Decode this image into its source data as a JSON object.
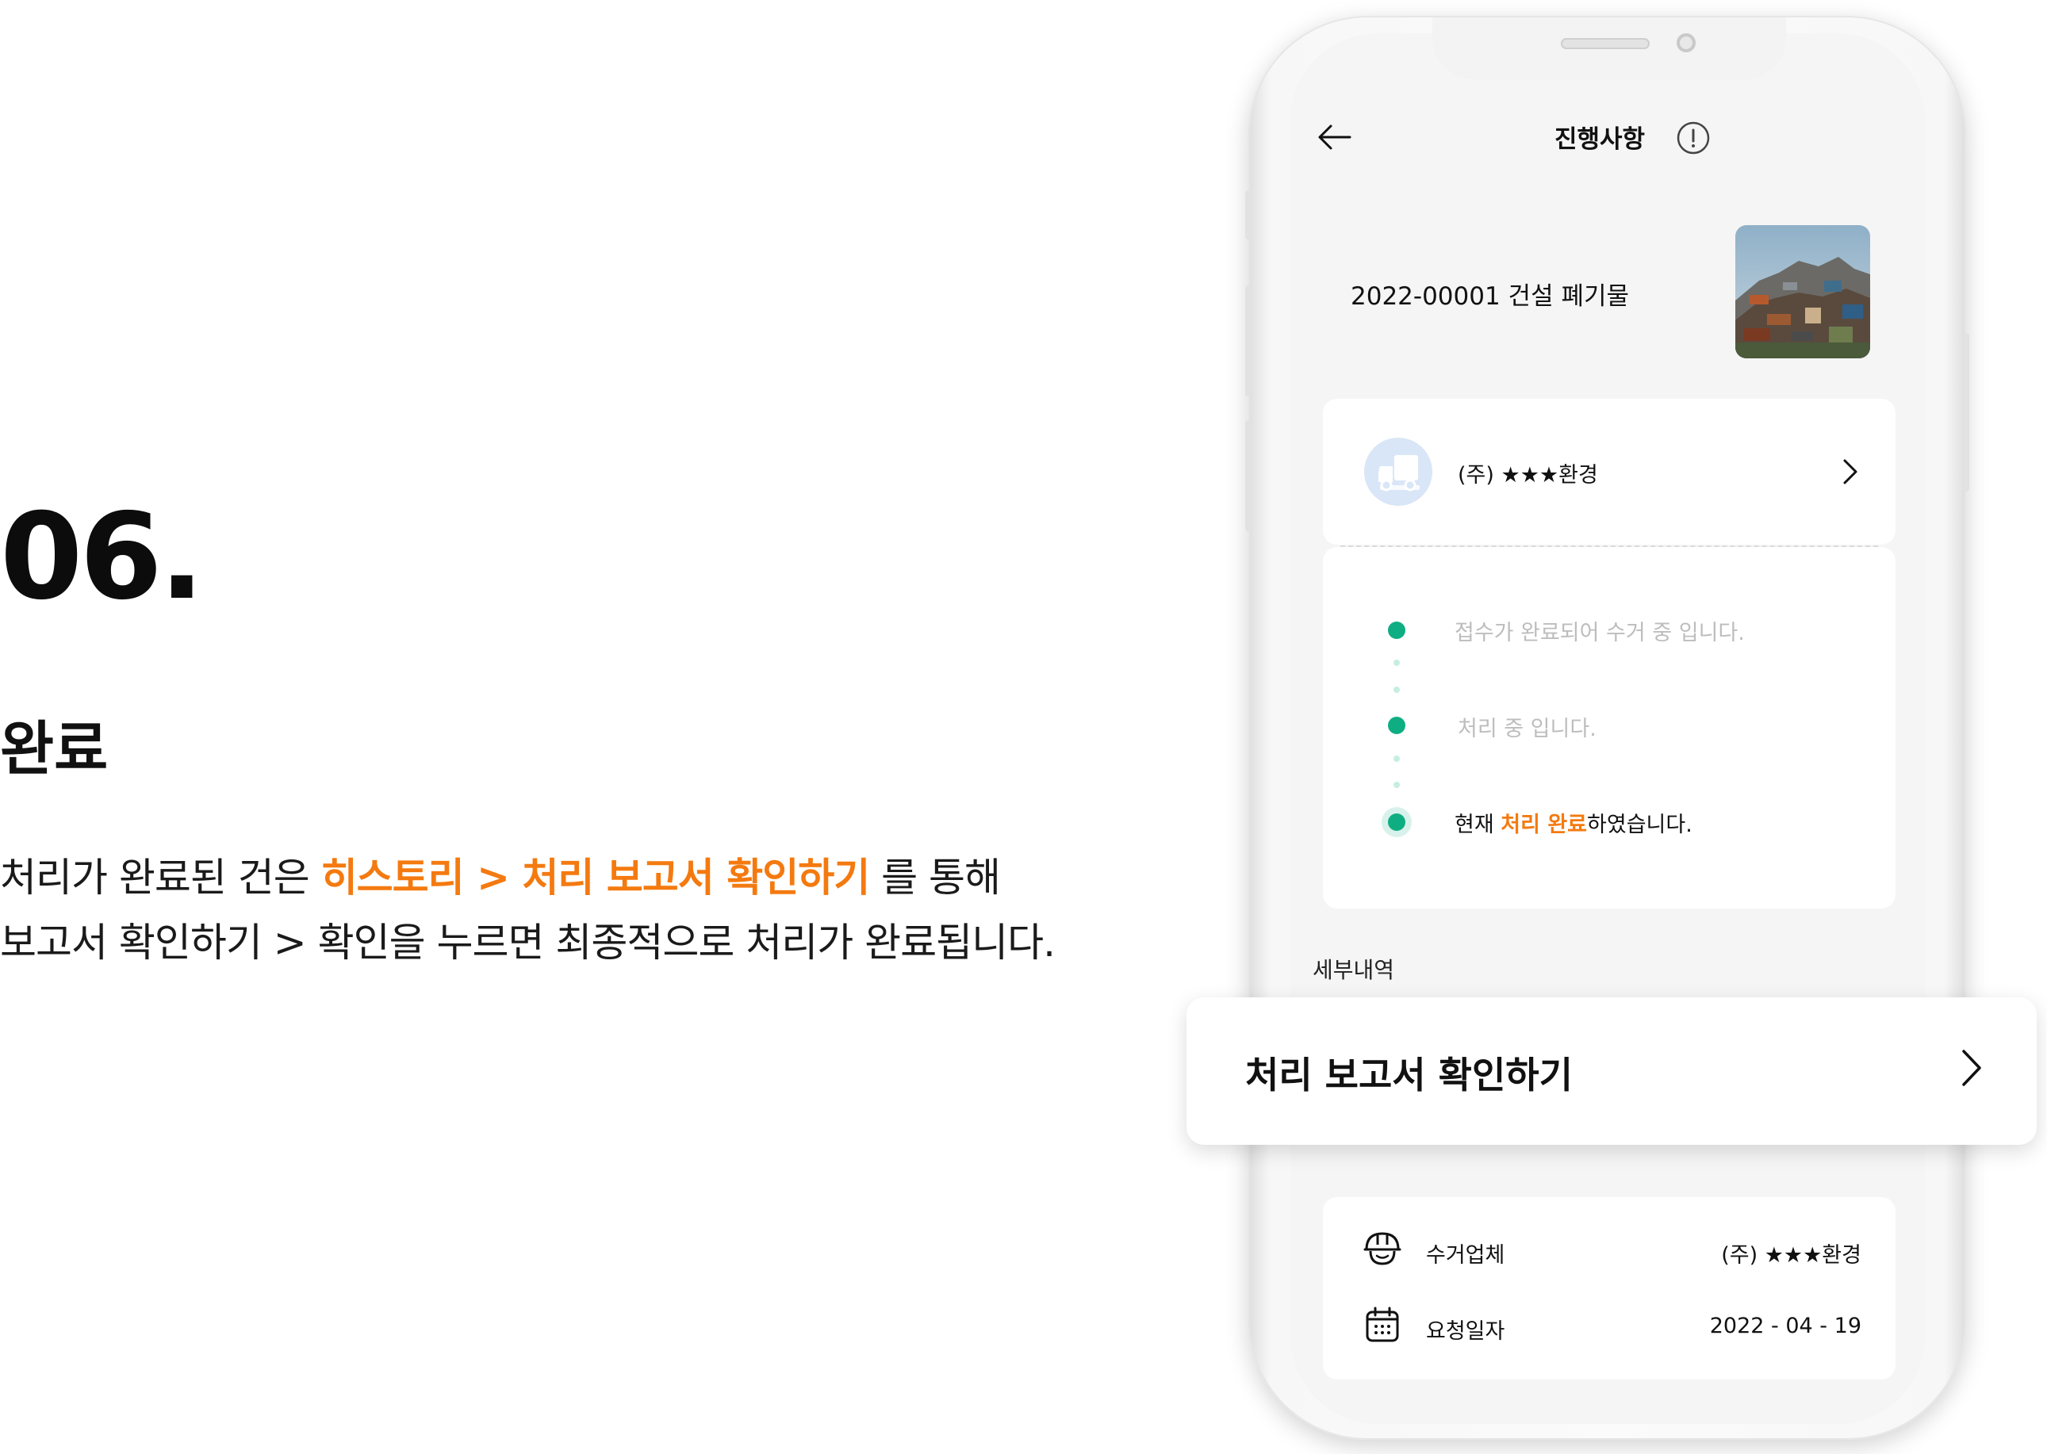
{
  "intro": {
    "step_number": "06.",
    "title": "완료",
    "desc_line1_a": "처리가 완료된 건은 ",
    "desc_line1_highlight": "히스토리 > 처리 보고서 확인하기",
    "desc_line1_b": " 를 통해",
    "desc_line2": "보고서 확인하기 > 확인을 누르면 최종적으로 처리가 완료됩니다."
  },
  "header": {
    "title": "진행사항",
    "back_icon": "arrow-left-icon",
    "info_icon": "info-circle-icon"
  },
  "request": {
    "title": "2022-00001 건설 폐기물",
    "thumbnail": "construction-waste-photo"
  },
  "company": {
    "name": "(주) ★★★환경",
    "icon": "truck-icon"
  },
  "timeline": {
    "step1": "접수가 완료되어 수거 중 입니다.",
    "step2": "처리 중 입니다.",
    "step3_a": "현재 ",
    "step3_highlight": "처리 완료",
    "step3_b": "하였습니다."
  },
  "details": {
    "section_label": "세부내역",
    "report_button": "처리 보고서 확인하기",
    "rows": [
      {
        "label": "수거업체",
        "value": "(주) ★★★환경",
        "icon": "hardhat-icon"
      },
      {
        "label": "요청일자",
        "value": "2022 - 04 - 19",
        "icon": "calendar-icon"
      }
    ]
  },
  "colors": {
    "accent": "#f47a10",
    "status_green": "#0fae82",
    "screen_bg": "#f5f5f5"
  }
}
